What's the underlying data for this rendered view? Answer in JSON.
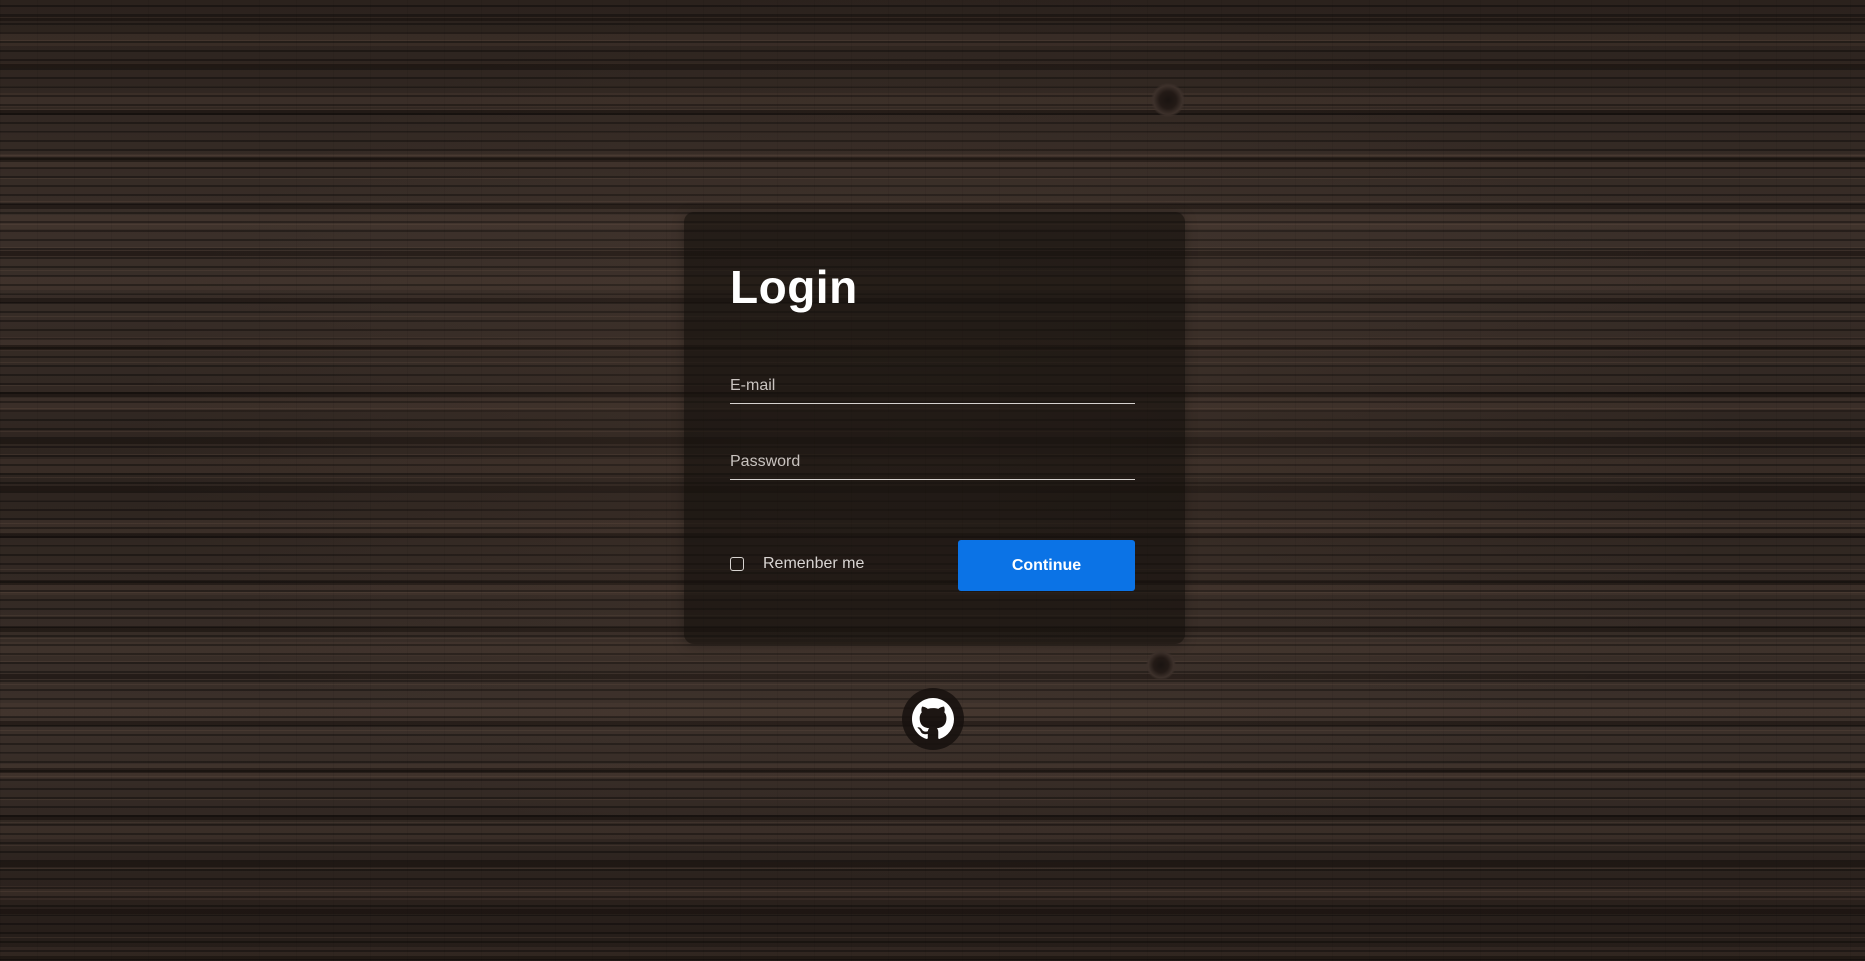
{
  "login": {
    "title": "Login",
    "email_placeholder": "E-mail",
    "password_placeholder": "Password",
    "remember_label": "Remenber me",
    "remember_checked": false,
    "continue_label": "Continue"
  },
  "footer": {
    "icon": "github-icon"
  },
  "colors": {
    "accent": "#0b73e6",
    "card_background": "rgba(18,13,11,0.58)",
    "text": "#ffffff"
  }
}
